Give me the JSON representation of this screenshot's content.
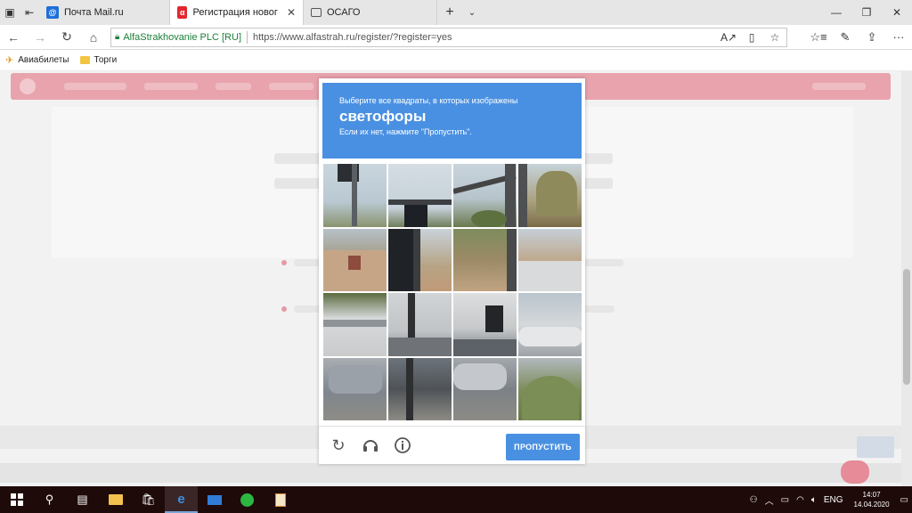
{
  "browser": {
    "tabs": [
      {
        "label": "Почта Mail.ru",
        "favicon": "mail-ru-icon",
        "active": false
      },
      {
        "label": "Регистрация нового по",
        "favicon": "alfa-icon",
        "active": true
      },
      {
        "label": "ОСАГО",
        "favicon": "page-icon",
        "active": false
      }
    ],
    "address": {
      "cert_label": "AlfaStrakhovanie PLC [RU]",
      "url": "https://www.alfastrah.ru/register/?register=yes"
    },
    "favorites": [
      {
        "label": "Авиабилеты",
        "icon": "plane-icon"
      },
      {
        "label": "Торги",
        "icon": "folder-icon"
      }
    ]
  },
  "captcha": {
    "instruction": "Выберите все квадраты, в которых изображены",
    "keyword": "светофоры",
    "hint": "Если их нет, нажмите \"Пропустить\".",
    "skip_label": "ПРОПУСТИТЬ",
    "accent_color": "#4a90e2",
    "grid_rows": 4,
    "grid_cols": 4
  },
  "taskbar": {
    "language": "ENG",
    "time": "14:07",
    "date": "14.04.2020"
  }
}
